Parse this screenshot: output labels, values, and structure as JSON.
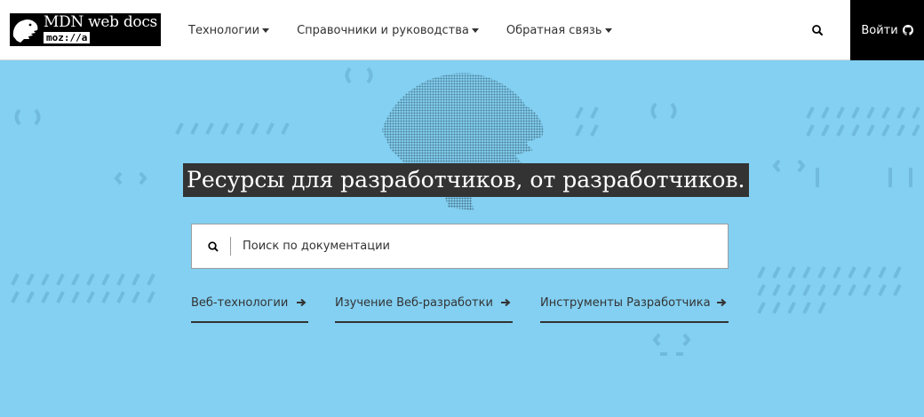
{
  "header": {
    "logo": {
      "main": "MDN web docs",
      "sub": "moz://a"
    },
    "nav": [
      {
        "label": "Технологии"
      },
      {
        "label": "Справочники и руководства"
      },
      {
        "label": "Обратная связь"
      }
    ],
    "signin_label": "Войти"
  },
  "hero": {
    "headline": "Ресурсы для разработчиков, от разработчиков.",
    "search_placeholder": "Поиск по документации",
    "links": [
      {
        "label": "Веб-технологии"
      },
      {
        "label": "Изучение Веб-разработки"
      },
      {
        "label": "Инструменты Разработчика"
      }
    ]
  },
  "colors": {
    "hero_background": "#83d0f2",
    "header_background": "#ffffff",
    "signin_background": "#000000",
    "headline_background": "#333333",
    "text": "#333333"
  },
  "icons": [
    "mdn-dino-logo-icon",
    "chevron-down-icon",
    "search-icon",
    "github-icon",
    "arrow-right-icon"
  ]
}
